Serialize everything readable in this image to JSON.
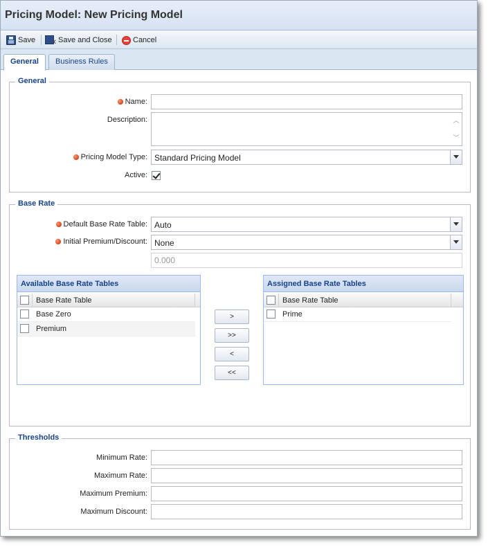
{
  "window": {
    "title": "Pricing Model: New Pricing Model"
  },
  "toolbar": {
    "save_label": "Save",
    "save_close_label": "Save and Close",
    "cancel_label": "Cancel"
  },
  "tabs": [
    {
      "label": "General",
      "active": true
    },
    {
      "label": "Business Rules",
      "active": false
    }
  ],
  "general": {
    "legend": "General",
    "name_label": "Name:",
    "name_value": "",
    "description_label": "Description:",
    "description_value": "",
    "type_label": "Pricing Model Type:",
    "type_value": "Standard Pricing Model",
    "active_label": "Active:",
    "active_checked": true
  },
  "base_rate": {
    "legend": "Base Rate",
    "default_table_label": "Default Base Rate Table:",
    "default_table_value": "Auto",
    "initial_premium_label": "Initial Premium/Discount:",
    "initial_premium_value": "None",
    "premium_amount_value": "0.000",
    "available": {
      "title": "Available Base Rate Tables",
      "column": "Base Rate Table",
      "rows": [
        "Base Zero",
        "Premium"
      ]
    },
    "assigned": {
      "title": "Assigned Base Rate Tables",
      "column": "Base Rate Table",
      "rows": [
        "Prime"
      ]
    },
    "buttons": {
      "move_right": ">",
      "move_all_right": ">>",
      "move_left": "<",
      "move_all_left": "<<"
    }
  },
  "thresholds": {
    "legend": "Thresholds",
    "min_rate_label": "Minimum Rate:",
    "max_rate_label": "Maximum Rate:",
    "max_premium_label": "Maximum Premium:",
    "max_discount_label": "Maximum Discount:"
  }
}
